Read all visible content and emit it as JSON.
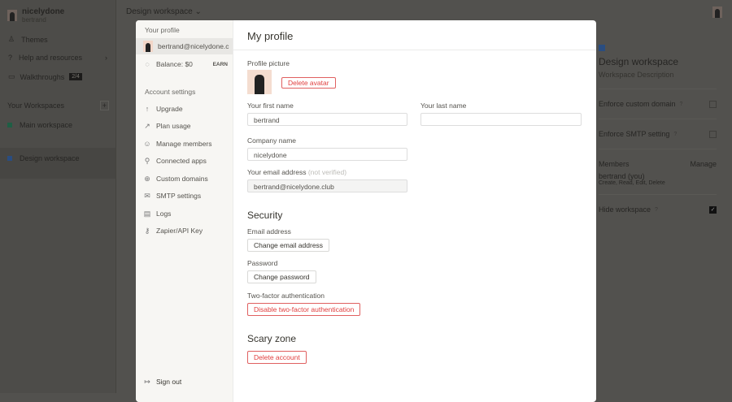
{
  "sidebar": {
    "workspace_name": "nicelydone",
    "user": "bertrand",
    "items": [
      {
        "label": "Themes"
      },
      {
        "label": "Help and resources"
      },
      {
        "label": "Walkthroughs",
        "badge": "2/4"
      }
    ],
    "workspaces_header": "Your Workspaces",
    "workspaces": [
      {
        "name": "Main workspace",
        "color": "#2f9e6e"
      },
      {
        "name": "Design workspace",
        "color": "#3b7ddd"
      }
    ]
  },
  "header": {
    "title": "Design workspace"
  },
  "panel": {
    "title": "Design workspace",
    "description": "Workspace Description",
    "enforce_domain": "Enforce custom domain",
    "enforce_smtp": "Enforce SMTP setting",
    "members": "Members",
    "manage": "Manage",
    "member_name": "bertrand (you)",
    "member_perms": "Create, Read, Edit, Delete",
    "hide": "Hide workspace",
    "help": "?"
  },
  "modal": {
    "nav": {
      "profile_header": "Your profile",
      "email": "bertrand@nicelydone.c",
      "balance": "Balance: $0",
      "earn": "EARN",
      "settings_header": "Account settings",
      "items": [
        {
          "label": "Upgrade",
          "icon": "↑"
        },
        {
          "label": "Plan usage",
          "icon": "↗"
        },
        {
          "label": "Manage members",
          "icon": "☺"
        },
        {
          "label": "Connected apps",
          "icon": "⚲"
        },
        {
          "label": "Custom domains",
          "icon": "⊕"
        },
        {
          "label": "SMTP settings",
          "icon": "✉"
        },
        {
          "label": "Logs",
          "icon": "▤"
        },
        {
          "label": "Zapier/API Key",
          "icon": "⚷"
        }
      ],
      "sign_out": "Sign out"
    },
    "title": "My profile",
    "profile_picture": "Profile picture",
    "delete_avatar": "Delete avatar",
    "first_name_label": "Your first name",
    "first_name": "bertrand",
    "last_name_label": "Your last name",
    "last_name": "",
    "company_label": "Company name",
    "company": "nicelydone",
    "email_label": "Your email address",
    "email_note": "(not verified)",
    "email": "bertrand@nicelydone.club",
    "security": "Security",
    "email_address": "Email address",
    "change_email": "Change email address",
    "password": "Password",
    "change_password": "Change password",
    "twofa": "Two-factor authentication",
    "disable_twofa": "Disable two-factor authentication",
    "scary": "Scary zone",
    "delete_account": "Delete account"
  }
}
